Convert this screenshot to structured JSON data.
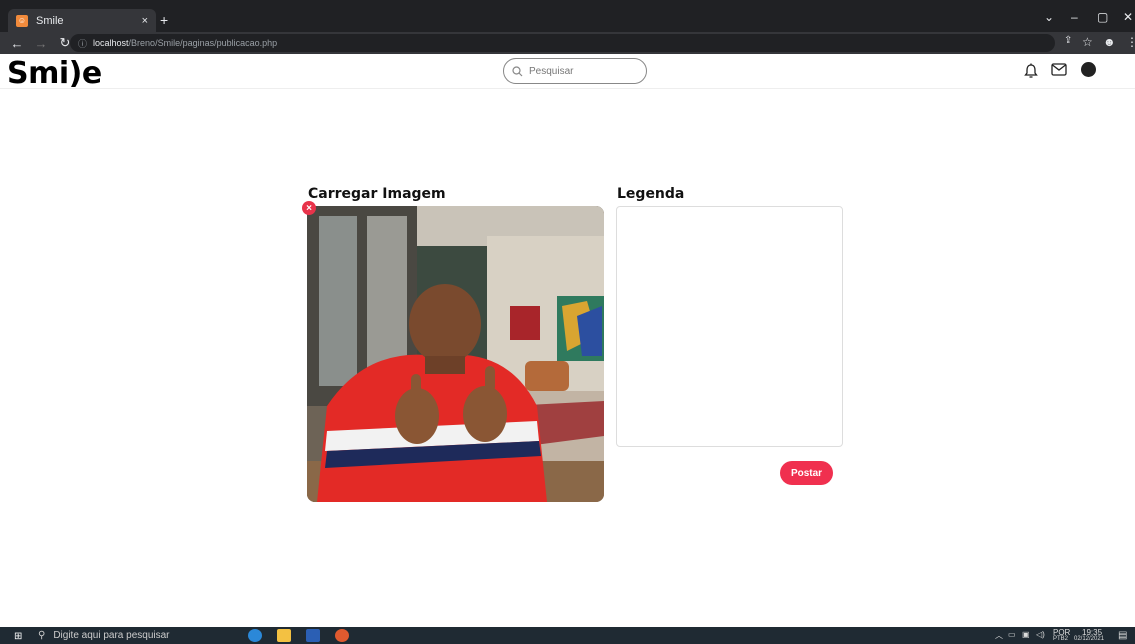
{
  "browser": {
    "tab_title": "Smile",
    "tab_close": "×",
    "new_tab": "+",
    "url_host": "localhost",
    "url_path": "/Breno/Smile/paginas/publicacao.php"
  },
  "site": {
    "logo": "Smi)e",
    "search_placeholder": "Pesquisar"
  },
  "upload": {
    "image_heading": "Carregar Imagem",
    "caption_heading": "Legenda",
    "caption_value": "",
    "remove_symbol": "×",
    "post_button": "Postar"
  },
  "taskbar": {
    "search_placeholder": "Digite aqui para pesquisar",
    "language": "POR",
    "language_sub": "PTB2",
    "time": "19:35",
    "date": "02/12/2021"
  },
  "icons": {
    "header": [
      "bell-icon",
      "mail-icon",
      "avatar"
    ],
    "nav": [
      "back-icon",
      "forward-icon",
      "reload-icon"
    ]
  }
}
